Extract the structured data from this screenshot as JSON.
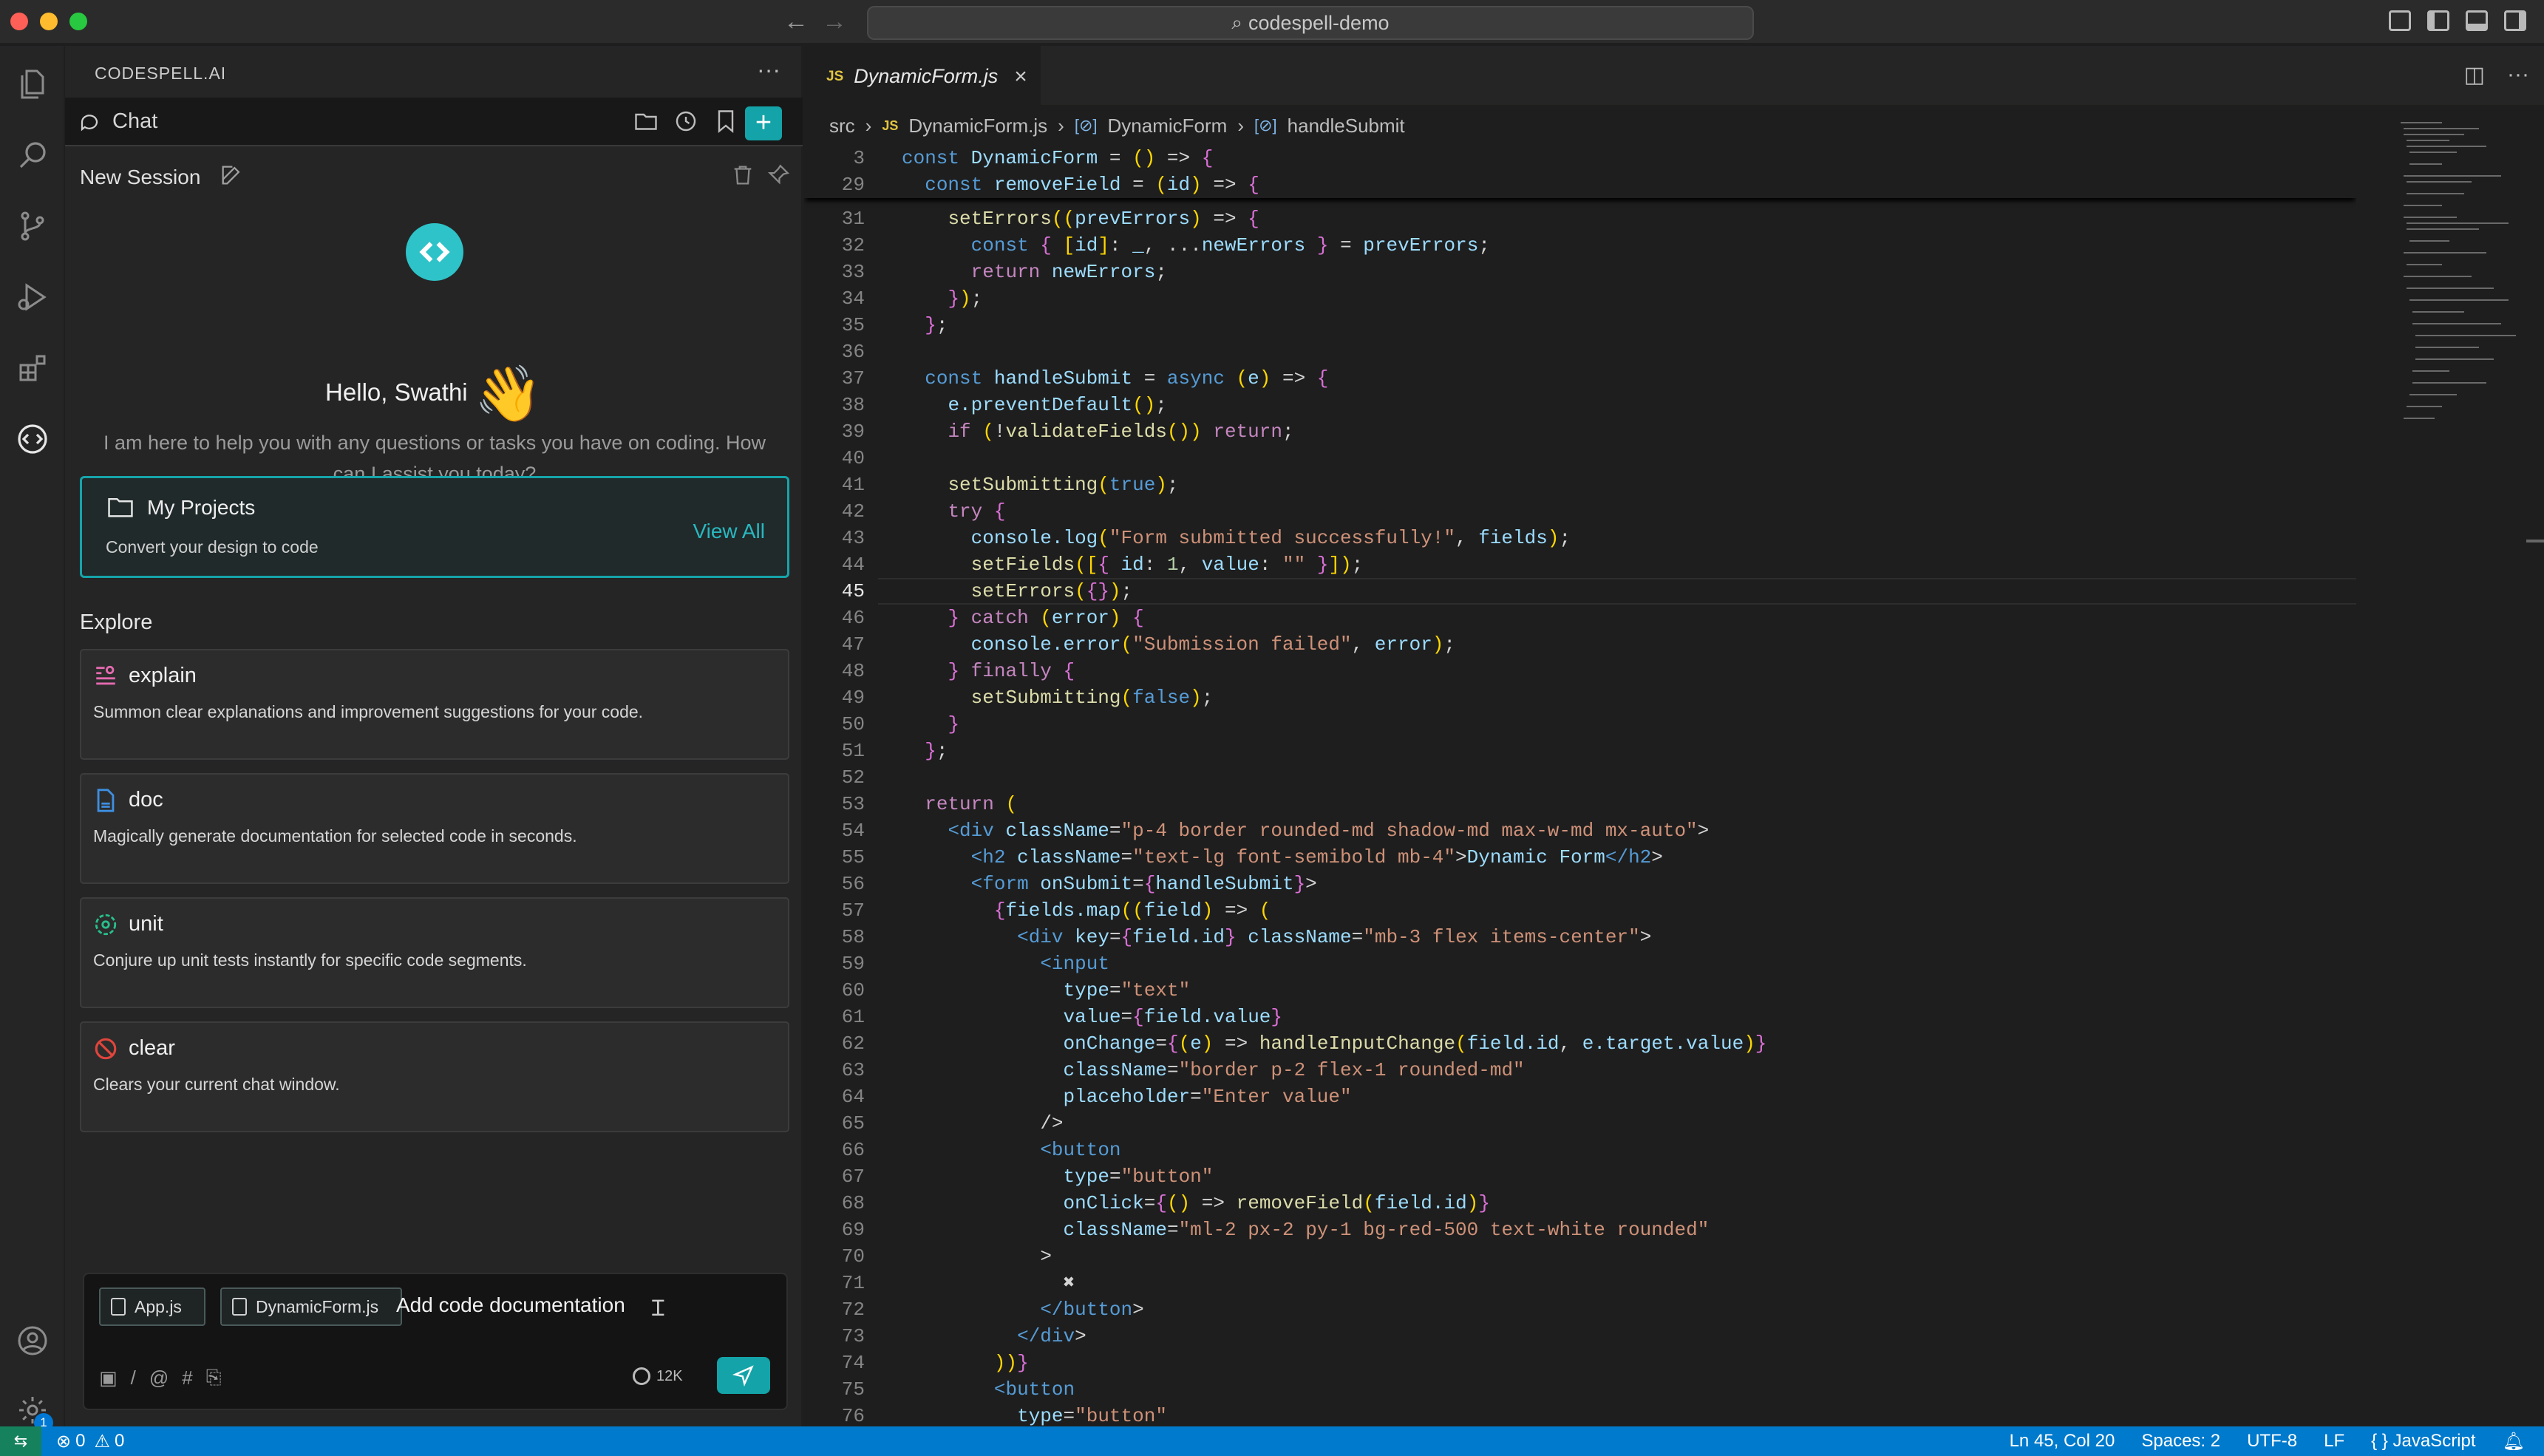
{
  "window": {
    "title": "codespell-demo"
  },
  "activity_bar": {
    "icons": [
      "files-icon",
      "search-icon",
      "source-control-icon",
      "run-debug-icon",
      "extensions-icon",
      "codespell-icon",
      "account-icon",
      "settings-icon"
    ],
    "settings_badge": "1"
  },
  "sidebar": {
    "title": "CODESPELL.AI",
    "chat_label": "Chat",
    "session_title": "New Session",
    "greeting": "Hello, Swathi",
    "greeting_emoji": "👋",
    "intro": "I am here to help you with any questions or tasks you have on coding. How can I assist you today?",
    "projects": {
      "title": "My Projects",
      "subtitle": "Convert your design to code",
      "view_all": "View All"
    },
    "explore_heading": "Explore",
    "cards": [
      {
        "title": "explain",
        "desc": "Summon clear explanations and improvement suggestions for your code.",
        "icon": "explain-icon",
        "color": "#e56bb0"
      },
      {
        "title": "doc",
        "desc": "Magically generate documentation for selected code in seconds.",
        "icon": "doc-icon",
        "color": "#3e8fe0"
      },
      {
        "title": "unit",
        "desc": "Conjure up unit tests instantly for specific code segments.",
        "icon": "unit-test-icon",
        "color": "#27c08a"
      },
      {
        "title": "clear",
        "desc": "Clears your current chat window.",
        "icon": "clear-icon",
        "color": "#e0453c"
      }
    ],
    "input": {
      "chips": [
        "App.js",
        "DynamicForm.js"
      ],
      "text": "Add code documentation",
      "tokens": "12K"
    }
  },
  "editor": {
    "tab": {
      "badge": "JS",
      "filename": "DynamicForm.js"
    },
    "breadcrumb": {
      "folder": "src",
      "file": "DynamicForm.js",
      "component": "DynamicForm",
      "function": "handleSubmit"
    },
    "current_line": "45",
    "sticky": [
      {
        "n": "3",
        "code": "const DynamicForm = () => {"
      },
      {
        "n": "29",
        "code": "  const removeField = (id) => {"
      }
    ],
    "lines": [
      {
        "n": "31",
        "code": "    setErrors((prevErrors) => {"
      },
      {
        "n": "32",
        "code": "      const { [id]: _, ...newErrors } = prevErrors;"
      },
      {
        "n": "33",
        "code": "      return newErrors;"
      },
      {
        "n": "34",
        "code": "    });"
      },
      {
        "n": "35",
        "code": "  };"
      },
      {
        "n": "36",
        "code": ""
      },
      {
        "n": "37",
        "code": "  const handleSubmit = async (e) => {"
      },
      {
        "n": "38",
        "code": "    e.preventDefault();"
      },
      {
        "n": "39",
        "code": "    if (!validateFields()) return;"
      },
      {
        "n": "40",
        "code": ""
      },
      {
        "n": "41",
        "code": "    setSubmitting(true);"
      },
      {
        "n": "42",
        "code": "    try {"
      },
      {
        "n": "43",
        "code": "      console.log(\"Form submitted successfully!\", fields);"
      },
      {
        "n": "44",
        "code": "      setFields([{ id: 1, value: \"\" }]);"
      },
      {
        "n": "45",
        "code": "      setErrors({});"
      },
      {
        "n": "46",
        "code": "    } catch (error) {"
      },
      {
        "n": "47",
        "code": "      console.error(\"Submission failed\", error);"
      },
      {
        "n": "48",
        "code": "    } finally {"
      },
      {
        "n": "49",
        "code": "      setSubmitting(false);"
      },
      {
        "n": "50",
        "code": "    }"
      },
      {
        "n": "51",
        "code": "  };"
      },
      {
        "n": "52",
        "code": ""
      },
      {
        "n": "53",
        "code": "  return ("
      },
      {
        "n": "54",
        "code": "    <div className=\"p-4 border rounded-md shadow-md max-w-md mx-auto\">"
      },
      {
        "n": "55",
        "code": "      <h2 className=\"text-lg font-semibold mb-4\">Dynamic Form</h2>"
      },
      {
        "n": "56",
        "code": "      <form onSubmit={handleSubmit}>"
      },
      {
        "n": "57",
        "code": "        {fields.map((field) => ("
      },
      {
        "n": "58",
        "code": "          <div key={field.id} className=\"mb-3 flex items-center\">"
      },
      {
        "n": "59",
        "code": "            <input"
      },
      {
        "n": "60",
        "code": "              type=\"text\""
      },
      {
        "n": "61",
        "code": "              value={field.value}"
      },
      {
        "n": "62",
        "code": "              onChange={(e) => handleInputChange(field.id, e.target.value)}"
      },
      {
        "n": "63",
        "code": "              className=\"border p-2 flex-1 rounded-md\""
      },
      {
        "n": "64",
        "code": "              placeholder=\"Enter value\""
      },
      {
        "n": "65",
        "code": "            />"
      },
      {
        "n": "66",
        "code": "            <button"
      },
      {
        "n": "67",
        "code": "              type=\"button\""
      },
      {
        "n": "68",
        "code": "              onClick={() => removeField(field.id)}"
      },
      {
        "n": "69",
        "code": "              className=\"ml-2 px-2 py-1 bg-red-500 text-white rounded\""
      },
      {
        "n": "70",
        "code": "            >"
      },
      {
        "n": "71",
        "code": "              ✖"
      },
      {
        "n": "72",
        "code": "            </button>"
      },
      {
        "n": "73",
        "code": "          </div>"
      },
      {
        "n": "74",
        "code": "        ))}"
      },
      {
        "n": "75",
        "code": "        <button"
      },
      {
        "n": "76",
        "code": "          type=\"button\""
      }
    ]
  },
  "status_bar": {
    "errors": "0",
    "warnings": "0",
    "position": "Ln 45, Col 20",
    "spaces": "Spaces: 2",
    "encoding": "UTF-8",
    "eol": "LF",
    "language": "JavaScript"
  }
}
